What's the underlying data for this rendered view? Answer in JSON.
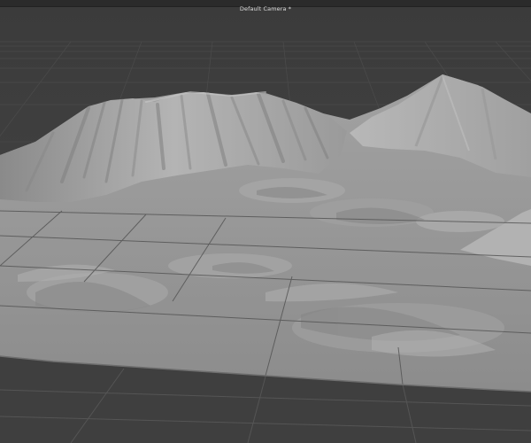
{
  "viewport": {
    "camera_label": "Default Camera *"
  }
}
